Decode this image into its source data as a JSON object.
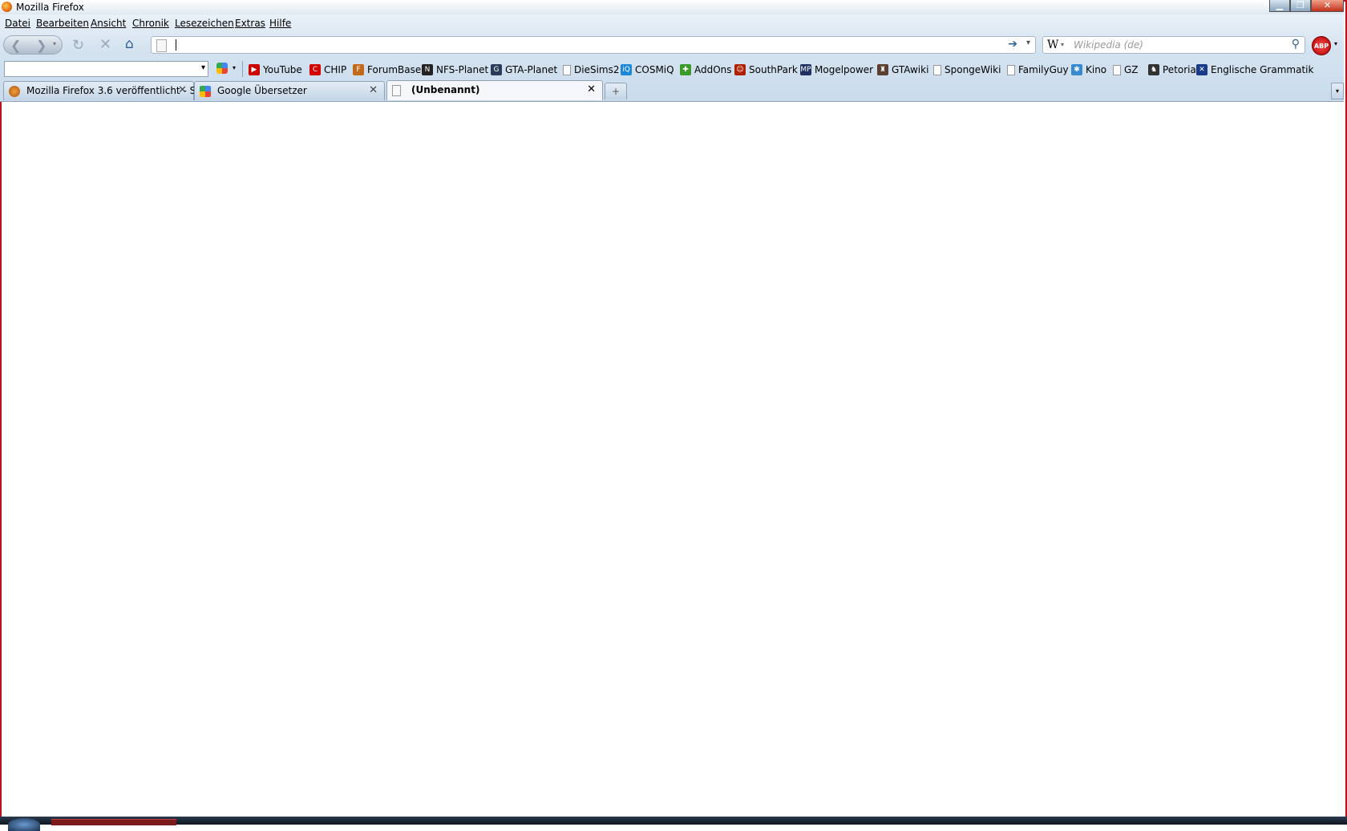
{
  "window": {
    "title": "Mozilla Firefox"
  },
  "menu": [
    "Datei",
    "Bearbeiten",
    "Ansicht",
    "Chronik",
    "Lesezeichen",
    "Extras",
    "Hilfe"
  ],
  "urlbar": {
    "value": ""
  },
  "search": {
    "engine_icon": "W",
    "placeholder": "Wikipedia (de)"
  },
  "abp": {
    "label": "ABP"
  },
  "bookmarks": [
    {
      "label": "YouTube",
      "icon": "youtube-icon",
      "color": "#cc0000",
      "glyph": "▶"
    },
    {
      "label": "CHIP",
      "icon": "chip-icon",
      "color": "#d40000",
      "glyph": "C"
    },
    {
      "label": "ForumBase",
      "icon": "forumbase-icon",
      "color": "#c36a1a",
      "glyph": "F"
    },
    {
      "label": "NFS-Planet",
      "icon": "nfs-planet-icon",
      "color": "#222222",
      "glyph": "N"
    },
    {
      "label": "GTA-Planet",
      "icon": "gta-planet-icon",
      "color": "#2a3c5a",
      "glyph": "G"
    },
    {
      "label": "DieSims2",
      "icon": "page-icon",
      "color": "#ffffff",
      "glyph": ""
    },
    {
      "label": "COSMiQ",
      "icon": "cosmiq-icon",
      "color": "#1e88d6",
      "glyph": "iQ"
    },
    {
      "label": "AddOns",
      "icon": "addons-icon",
      "color": "#3a9a2a",
      "glyph": "✚"
    },
    {
      "label": "SouthPark",
      "icon": "southpark-icon",
      "color": "#b02000",
      "glyph": "☺"
    },
    {
      "label": "Mogelpower",
      "icon": "mogelpower-icon",
      "color": "#203060",
      "glyph": "MP"
    },
    {
      "label": "GTAwiki",
      "icon": "gtawiki-icon",
      "color": "#5a4030",
      "glyph": "♜"
    },
    {
      "label": "SpongeWiki",
      "icon": "page-icon",
      "color": "#ffffff",
      "glyph": ""
    },
    {
      "label": "FamilyGuy",
      "icon": "page-icon",
      "color": "#ffffff",
      "glyph": ""
    },
    {
      "label": "Kino",
      "icon": "kino-icon",
      "color": "#3a8ad0",
      "glyph": "✱"
    },
    {
      "label": "GZ",
      "icon": "page-icon",
      "color": "#ffffff",
      "glyph": ""
    },
    {
      "label": "Petoria",
      "icon": "petoria-icon",
      "color": "#333333",
      "glyph": "♞"
    },
    {
      "label": "Englische Grammatik",
      "icon": "uk-flag-icon",
      "color": "#1a3a8a",
      "glyph": "✕"
    }
  ],
  "tabs": [
    {
      "label": "Mozilla Firefox 3.6 veröffentlicht - S...",
      "icon": "forumbase-icon",
      "selected": false
    },
    {
      "label": "Google Übersetzer",
      "icon": "google-icon",
      "selected": false
    },
    {
      "label": "(Unbenannt)",
      "icon": "page-icon",
      "selected": true
    }
  ],
  "new_tab_glyph": "+",
  "close_glyph": "✕"
}
